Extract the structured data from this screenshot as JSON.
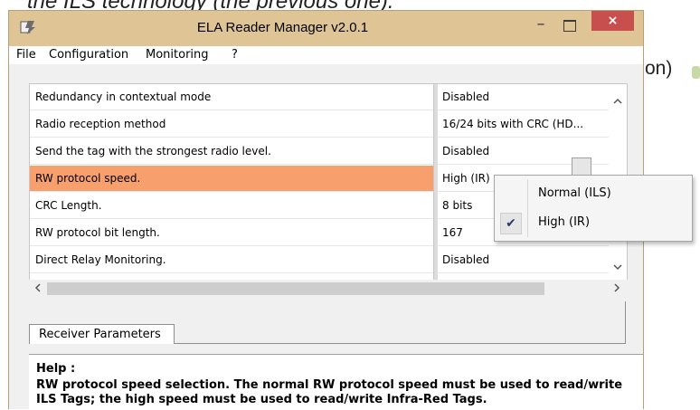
{
  "background": {
    "top_text": "the ILS technology (the previous one).",
    "right_text": "on)"
  },
  "window": {
    "title": "ELA Reader Manager v2.0.1",
    "minimize_label": "–",
    "close_label": "×",
    "accent": "#dfc596",
    "close_color": "#c7504f"
  },
  "menu": {
    "items": [
      "File",
      "Configuration",
      "Monitoring",
      "?"
    ]
  },
  "grid": {
    "rows": [
      {
        "name": "Redundancy in contextual mode",
        "value": "Disabled"
      },
      {
        "name": "Radio reception method",
        "value": "16/24 bits with CRC (HD..."
      },
      {
        "name": "Send the tag with the strongest radio level.",
        "value": "Disabled"
      },
      {
        "name": "RW protocol speed.",
        "value": "High (IR)"
      },
      {
        "name": "CRC Length.",
        "value": "8 bits"
      },
      {
        "name": "RW protocol bit length.",
        "value": "167"
      },
      {
        "name": "Direct Relay Monitoring.",
        "value": "Disabled"
      }
    ],
    "selected_color": "#f7a06e",
    "scroll_up": "^",
    "scroll_down": "v",
    "scroll_left": "<",
    "scroll_right": ">"
  },
  "dropdown": {
    "options": [
      {
        "label": "Normal (ILS)",
        "checked": false
      },
      {
        "label": "High (IR)",
        "checked": true
      }
    ],
    "check_glyph": "✔"
  },
  "tabs": {
    "active": "Receiver Parameters"
  },
  "help": {
    "title": "Help :",
    "text": "RW protocol speed selection. The normal RW protocol speed must be used to read/write ILS Tags; the high speed must be used to read/write Infra-Red Tags."
  }
}
